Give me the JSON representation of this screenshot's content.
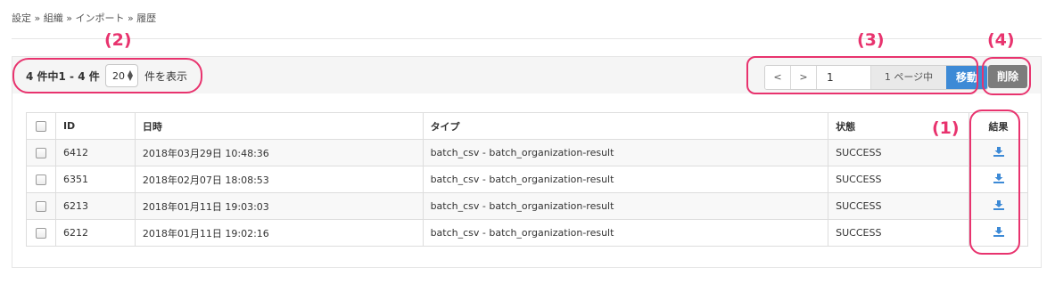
{
  "breadcrumb": {
    "text": "設定 » 組織 » インポート » 履歴"
  },
  "toolbar": {
    "count_text": "4 件中1 - 4 件",
    "per_page_value": "20",
    "per_page_suffix": "件を表示",
    "pager": {
      "prev": "<",
      "next": ">",
      "page_value": "1",
      "total_text": "1 ページ中",
      "go_label": "移動"
    },
    "delete_label": "削除"
  },
  "table": {
    "headers": {
      "id": "ID",
      "datetime": "日時",
      "type": "タイプ",
      "status": "状態",
      "result": "結果"
    },
    "rows": [
      {
        "id": "6412",
        "datetime": "2018年03月29日 10:48:36",
        "type": "batch_csv - batch_organization-result",
        "status": "SUCCESS"
      },
      {
        "id": "6351",
        "datetime": "2018年02月07日 18:08:53",
        "type": "batch_csv - batch_organization-result",
        "status": "SUCCESS"
      },
      {
        "id": "6213",
        "datetime": "2018年01月11日 19:03:03",
        "type": "batch_csv - batch_organization-result",
        "status": "SUCCESS"
      },
      {
        "id": "6212",
        "datetime": "2018年01月11日 19:02:16",
        "type": "batch_csv - batch_organization-result",
        "status": "SUCCESS"
      }
    ]
  },
  "annotations": {
    "label_1": "(1)",
    "label_2": "(2)",
    "label_3": "(3)",
    "label_4": "(4)"
  },
  "icons": {
    "download": "download-icon",
    "per_page_arrows": "select-arrows-icon"
  },
  "colors": {
    "accent": "#3d8ad6",
    "delete": "#7c7c7c",
    "highlight": "#e8336e"
  }
}
